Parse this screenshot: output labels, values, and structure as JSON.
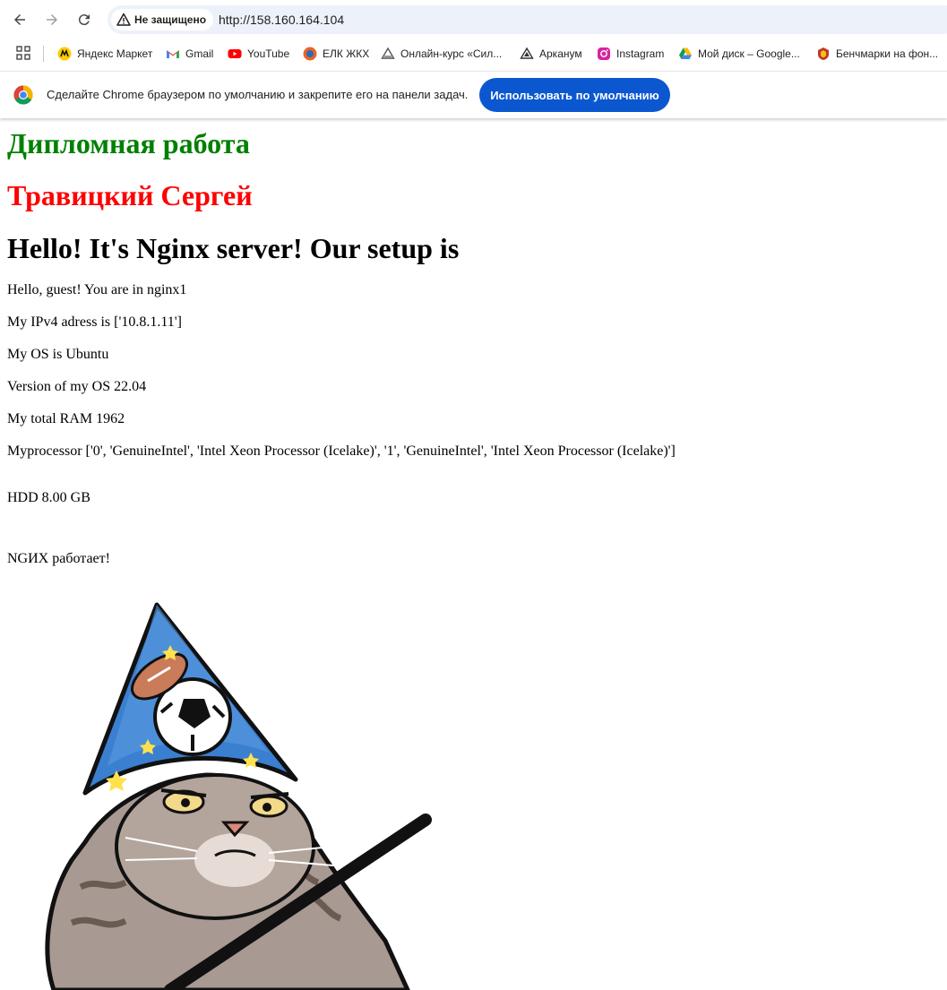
{
  "browser": {
    "security_label": "Не защищено",
    "url": "http://158.160.164.104",
    "bookmarks": [
      {
        "label": "Яндекс Маркет",
        "icon": "yandex-market-icon"
      },
      {
        "label": "Gmail",
        "icon": "gmail-icon"
      },
      {
        "label": "YouTube",
        "icon": "youtube-icon"
      },
      {
        "label": "ЕЛК ЖКХ",
        "icon": "elk-icon"
      },
      {
        "label": "Онлайн-курс «Сил...",
        "icon": "course-icon"
      },
      {
        "label": "Арканум",
        "icon": "arkanum-icon"
      },
      {
        "label": "Instagram",
        "icon": "instagram-icon"
      },
      {
        "label": "Мой диск – Google...",
        "icon": "google-drive-icon"
      },
      {
        "label": "Бенчмарки на фон...",
        "icon": "benchmark-icon"
      }
    ],
    "infobar": {
      "text": "Сделайте Chrome браузером по умолчанию и закрепите его на панели задач.",
      "button": "Использовать по умолчанию"
    }
  },
  "page": {
    "heading_green": "Дипломная работа",
    "heading_red": "Травицкий Сергей",
    "heading_main": "Hello! It's Nginx server! Our setup is",
    "lines": [
      "Hello, guest! You are in nginx1",
      "My IPv4 adress is ['10.8.1.11']",
      "My OS is Ubuntu",
      "Version of my OS 22.04",
      "My total RAM 1962",
      "Myprocessor ['0', 'GenuineIntel', 'Intel Xeon Processor (Icelake)', '1', 'GenuineIntel', 'Intel Xeon Processor (Icelake)']",
      "HDD 8.00 GB",
      "NGИХ работает!"
    ]
  },
  "colors": {
    "green": "#008000",
    "red": "#ff0000",
    "accent": "#0b57d0"
  }
}
